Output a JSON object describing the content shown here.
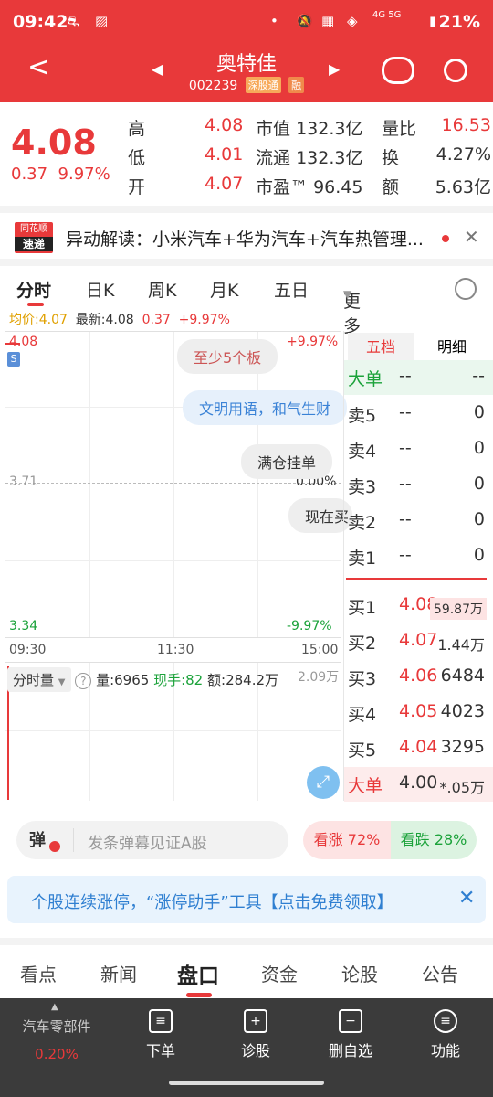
{
  "status": {
    "time": "09:42",
    "battery": "21%",
    "network": "4G 5G"
  },
  "header": {
    "title": "奥特佳",
    "code": "002239",
    "tag1": "深股通",
    "tag2": "融"
  },
  "quote": {
    "price": "4.08",
    "change": "0.37",
    "change_pct": "9.97%",
    "high_label": "高",
    "high": "4.08",
    "low_label": "低",
    "low": "4.01",
    "open_label": "开",
    "open": "4.07",
    "mktcap_label": "市值",
    "mktcap": "132.3亿",
    "float_label": "流通",
    "float": "132.3亿",
    "pe_label": "市盈™",
    "pe": "96.45",
    "volratio_label": "量比",
    "volratio": "16.53",
    "turnover_label": "换",
    "turnover": "4.27%",
    "amount_label": "额",
    "amount": "5.63亿"
  },
  "news": {
    "logo_top": "同花顺",
    "logo_bottom": "速递",
    "text": "异动解读：小米汽车+华为汽车+汽车热管理..."
  },
  "chart_tabs": [
    "分时",
    "日K",
    "周K",
    "月K",
    "五日",
    "更多"
  ],
  "avg_line": {
    "label": "均价:4.07",
    "latest": "最新:4.08",
    "chg": "0.37",
    "pct": "+9.97%"
  },
  "chart": {
    "top_price": "4.08",
    "mid_price": "3.71",
    "bottom_price": "3.34",
    "top_pct": "+9.97%",
    "mid_pct": "0.00%",
    "bottom_pct": "-9.97%",
    "s_badge": "S",
    "bubbles": [
      "至少5个板",
      "文明用语，和气生财",
      "满仓挂单",
      "现在买"
    ],
    "time_start": "09:30",
    "time_mid": "11:30",
    "time_end": "15:00"
  },
  "volume": {
    "tab": "分时量",
    "vol": "量:6965",
    "now": "现手:82",
    "amount": "额:284.2万",
    "right": "2.09万"
  },
  "order_book": {
    "tabs": [
      "五档",
      "明细"
    ],
    "big_sell": {
      "label": "大单",
      "p": "--",
      "v": "--"
    },
    "sells": [
      {
        "label": "卖5",
        "p": "--",
        "v": "0"
      },
      {
        "label": "卖4",
        "p": "--",
        "v": "0"
      },
      {
        "label": "卖3",
        "p": "--",
        "v": "0"
      },
      {
        "label": "卖2",
        "p": "--",
        "v": "0"
      },
      {
        "label": "卖1",
        "p": "--",
        "v": "0"
      }
    ],
    "buys": [
      {
        "label": "买1",
        "p": "4.08",
        "v": "59.87万"
      },
      {
        "label": "买2",
        "p": "4.07",
        "v": "1.44万"
      },
      {
        "label": "买3",
        "p": "4.06",
        "v": "6484"
      },
      {
        "label": "买4",
        "p": "4.05",
        "v": "4023"
      },
      {
        "label": "买5",
        "p": "4.04",
        "v": "3295"
      }
    ],
    "big_buy": {
      "label": "大单",
      "p": "4.00",
      "v": "*.05万"
    }
  },
  "barrage": {
    "icon_label": "弹",
    "placeholder": "发条弹幕见证A股",
    "up": "看涨 72%",
    "down": "看跌 28%"
  },
  "promo": {
    "text": "个股连续涨停，“涨停助手”工具【点击免费领取】"
  },
  "bottom_tabs": [
    "看点",
    "新闻",
    "盘口",
    "资金",
    "论股",
    "公告"
  ],
  "bottom_bar": {
    "sector": "汽车零部件",
    "sector_pct": "0.20%",
    "items": [
      "下单",
      "诊股",
      "删自选",
      "功能"
    ]
  }
}
